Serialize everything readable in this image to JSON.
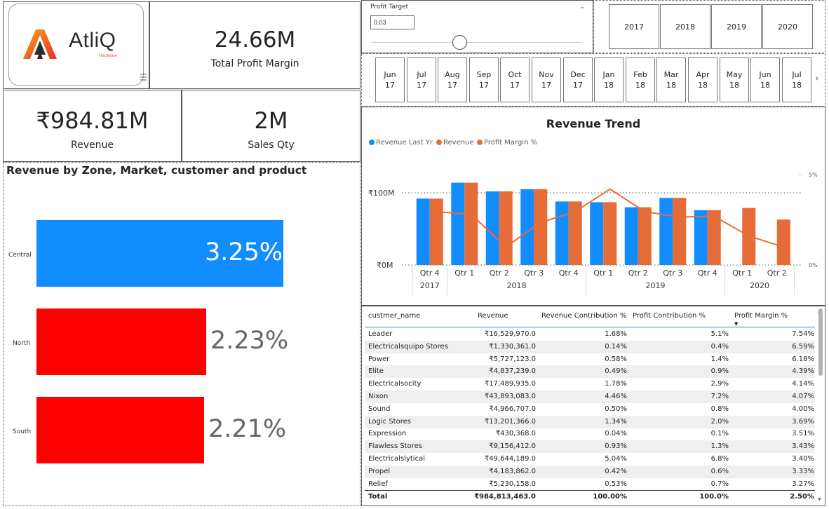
{
  "logo": {
    "name": "AtliQ",
    "sub": "Hardware"
  },
  "kpis": {
    "profit_margin": {
      "value": "24.66M",
      "label": "Total Profit Margin"
    },
    "revenue": {
      "value": "₹984.81M",
      "label": "Revenue"
    },
    "sales_qty": {
      "value": "2M",
      "label": "Sales Qty"
    }
  },
  "zone_chart": {
    "title": "Revenue by Zone, Market, customer and product",
    "zones": [
      {
        "label": "Central",
        "value": "3.25%",
        "pct": 3.25,
        "color": "#118dff",
        "inside": true
      },
      {
        "label": "North",
        "value": "2.23%",
        "pct": 2.23,
        "color": "#ff0000",
        "inside": false
      },
      {
        "label": "South",
        "value": "2.21%",
        "pct": 2.21,
        "color": "#ff0000",
        "inside": false
      }
    ]
  },
  "profit_target": {
    "title": "Profit Target",
    "value": "0.03",
    "slider_fraction": 0.42
  },
  "years": [
    "2017",
    "2018",
    "2019",
    "2020"
  ],
  "months": [
    {
      "m": "Jun",
      "y": "17"
    },
    {
      "m": "Jul",
      "y": "17"
    },
    {
      "m": "Aug",
      "y": "17"
    },
    {
      "m": "Sep",
      "y": "17"
    },
    {
      "m": "Oct",
      "y": "17"
    },
    {
      "m": "Nov",
      "y": "17"
    },
    {
      "m": "Dec",
      "y": "17"
    },
    {
      "m": "Jan",
      "y": "18"
    },
    {
      "m": "Feb",
      "y": "18"
    },
    {
      "m": "Mar",
      "y": "18"
    },
    {
      "m": "Apr",
      "y": "18"
    },
    {
      "m": "May",
      "y": "18"
    },
    {
      "m": "Jun",
      "y": "18"
    },
    {
      "m": "Jul",
      "y": "18"
    }
  ],
  "chart_data": {
    "type": "bar",
    "title": "Revenue Trend",
    "categories": [
      "Qtr 4",
      "Qtr 1",
      "Qtr 2",
      "Qtr 3",
      "Qtr 4",
      "Qtr 1",
      "Qtr 2",
      "Qtr 3",
      "Qtr 4",
      "Qtr 1",
      "Qtr 2"
    ],
    "year_groups": [
      {
        "label": "2017",
        "span": 1
      },
      {
        "label": "2018",
        "span": 4
      },
      {
        "label": "2019",
        "span": 4
      },
      {
        "label": "2020",
        "span": 2
      }
    ],
    "series": [
      {
        "name": "Revenue Last Yr.",
        "color": "#118dff",
        "values": [
          92,
          114,
          102,
          105,
          88,
          87,
          80,
          93,
          76,
          null,
          null
        ]
      },
      {
        "name": "Revenue",
        "color": "#e66c37",
        "values": [
          92,
          114,
          102,
          105,
          88,
          87,
          80,
          93,
          76,
          79,
          63
        ]
      }
    ],
    "line": {
      "name": "Profit Margin %",
      "color": "#e66c37",
      "values": [
        2.95,
        2.8,
        1.0,
        2.35,
        2.95,
        4.2,
        2.95,
        2.65,
        2.7,
        1.6,
        1.0
      ]
    },
    "y_ticks": [
      "₹0M",
      "₹100M"
    ],
    "ylim": [
      0,
      140
    ],
    "y2_ticks": [
      "0%",
      "5%"
    ],
    "y2lim": [
      0,
      5
    ],
    "legend_position": "top-left"
  },
  "table": {
    "headers": [
      "custmer_name",
      "Revenue",
      "Revenue Contribution %",
      "Profit Contribution %",
      "Profit Margin %"
    ],
    "rows": [
      [
        "Leader",
        "₹16,529,970.0",
        "1.68%",
        "5.1%",
        "7.54%"
      ],
      [
        "Electricalsquipo Stores",
        "₹1,330,361.0",
        "0.14%",
        "0.4%",
        "6.59%"
      ],
      [
        "Power",
        "₹5,727,123.0",
        "0.58%",
        "1.4%",
        "6.18%"
      ],
      [
        "Elite",
        "₹4,837,239.0",
        "0.49%",
        "0.9%",
        "4.39%"
      ],
      [
        "Electricalsocity",
        "₹17,489,935.0",
        "1.78%",
        "2.9%",
        "4.14%"
      ],
      [
        "Nixon",
        "₹43,893,083.0",
        "4.46%",
        "7.2%",
        "4.07%"
      ],
      [
        "Sound",
        "₹4,966,707.0",
        "0.50%",
        "0.8%",
        "4.00%"
      ],
      [
        "Logic Stores",
        "₹13,201,366.0",
        "1.34%",
        "2.0%",
        "3.69%"
      ],
      [
        "Expression",
        "₹430,368.0",
        "0.04%",
        "0.1%",
        "3.51%"
      ],
      [
        "Flawless Stores",
        "₹9,156,412.0",
        "0.93%",
        "1.3%",
        "3.43%"
      ],
      [
        "Electricalslytical",
        "₹49,644,189.0",
        "5.04%",
        "6.8%",
        "3.40%"
      ],
      [
        "Propel",
        "₹4,183,862.0",
        "0.42%",
        "0.6%",
        "3.33%"
      ],
      [
        "Relief",
        "₹5,230,158.0",
        "0.53%",
        "0.7%",
        "3.27%"
      ]
    ],
    "total": [
      "Total",
      "₹984,813,463.0",
      "100.00%",
      "100.0%",
      "2.50%"
    ]
  }
}
